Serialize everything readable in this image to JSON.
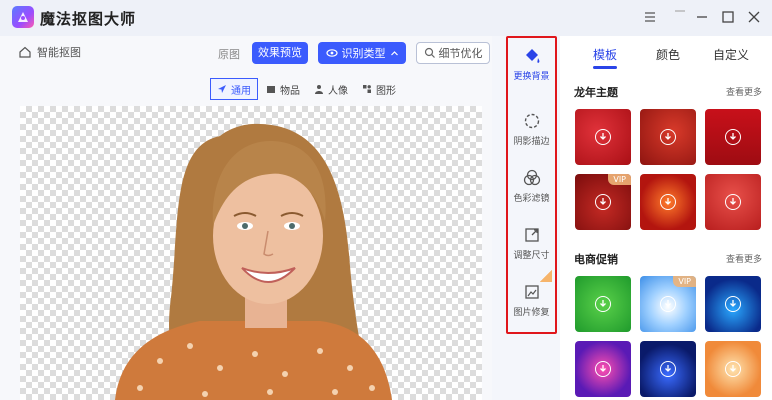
{
  "app": {
    "title": "魔法抠图大师"
  },
  "toolbar": {
    "home_label": "智能抠图",
    "original_label": "原图",
    "preview_label": "效果预览",
    "recognize_label": "识别类型",
    "detail_label": "细节优化"
  },
  "categories": [
    "通用",
    "物品",
    "人像",
    "图形"
  ],
  "side_tools": [
    "更换背景",
    "阴影描边",
    "色彩滤镜",
    "调整尺寸",
    "图片修复"
  ],
  "tabs": [
    "模板",
    "颜色",
    "自定义"
  ],
  "sections": [
    {
      "title": "龙年主题",
      "more": "查看更多"
    },
    {
      "title": "电商促销",
      "more": "查看更多"
    }
  ],
  "vip_label": "VIP",
  "colors": {
    "accent": "#3b5bfd",
    "highlight_frame": "#e0161b",
    "active_tab": "#2a44e8"
  }
}
